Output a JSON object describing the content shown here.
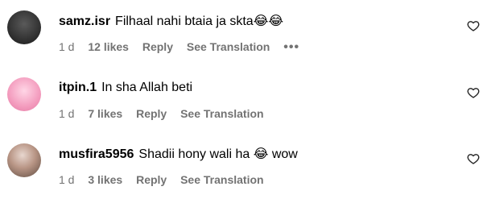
{
  "comments": [
    {
      "username": "samz.isr",
      "text": "Filhaal nahi btaia ja skta",
      "emoji_after": "😂😂",
      "time": "1 d",
      "likes": "12 likes",
      "reply": "Reply",
      "see_translation": "See Translation",
      "more": "•••",
      "like_icon": "heart-icon"
    },
    {
      "username": "itpin.1",
      "text": "In sha Allah beti",
      "emoji_after": "",
      "time": "1 d",
      "likes": "7 likes",
      "reply": "Reply",
      "see_translation": "See Translation",
      "like_icon": "heart-icon"
    },
    {
      "username": "musfira5956",
      "text": "Shadii hony wali ha ",
      "emoji_after": "😂",
      "text_after": " wow",
      "time": "1 d",
      "likes": "3 likes",
      "reply": "Reply",
      "see_translation": "See Translation",
      "like_icon": "heart-icon"
    }
  ]
}
